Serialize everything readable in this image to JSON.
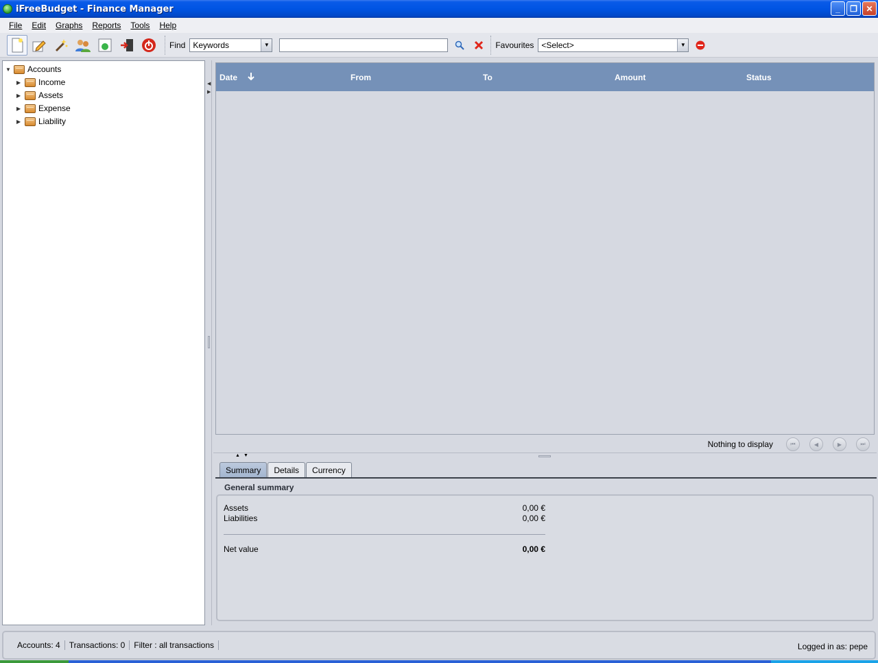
{
  "window": {
    "title": "iFreeBudget - Finance Manager"
  },
  "menu": [
    {
      "label": "File"
    },
    {
      "label": "Edit"
    },
    {
      "label": "Graphs"
    },
    {
      "label": "Reports"
    },
    {
      "label": "Tools"
    },
    {
      "label": "Help"
    }
  ],
  "toolbar": {
    "find_label": "Find",
    "find_type": "Keywords",
    "search_value": "",
    "favourites_label": "Favourites",
    "favourites_value": "<Select>"
  },
  "tree": {
    "root": "Accounts",
    "children": [
      "Income",
      "Assets",
      "Expense",
      "Liability"
    ]
  },
  "table": {
    "columns": [
      "Date",
      "From",
      "To",
      "Amount",
      "Status"
    ],
    "rows": [],
    "pager_text": "Nothing to display"
  },
  "tabs": [
    "Summary",
    "Details",
    "Currency"
  ],
  "summary": {
    "title": "General summary",
    "assets_label": "Assets",
    "assets_value": "0,00 €",
    "liabilities_label": "Liabilities",
    "liabilities_value": "0,00 €",
    "net_label": "Net value",
    "net_value": "0,00 €"
  },
  "status": {
    "accounts": "Accounts: 4",
    "transactions": "Transactions: 0",
    "filter": "Filter : all transactions",
    "user": "Logged in as: pepe"
  }
}
